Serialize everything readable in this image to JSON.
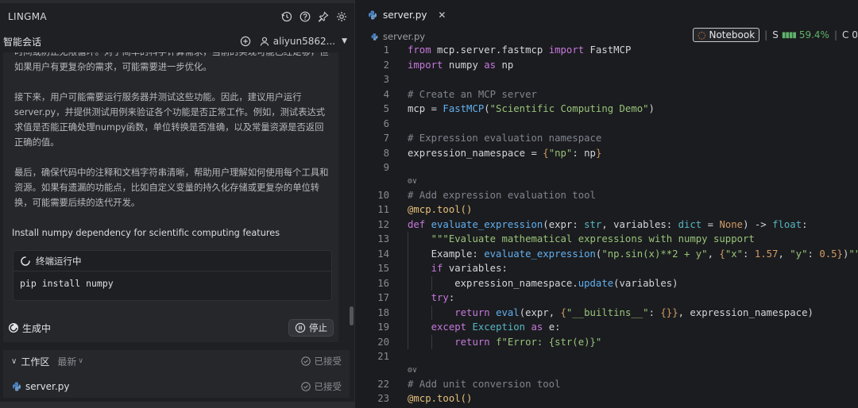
{
  "left_panel": {
    "app_title": "LINGMA",
    "header_icons": [
      "history-icon",
      "help-icon",
      "pin-icon",
      "settings-icon"
    ],
    "conversation": {
      "title": "智能会话",
      "user": "aliyun5862...",
      "paragraphs": [
        "时间或防止无限循环。对于简单的科学计算需求，当前的实现可能已经足够，但如果用户有更复杂的需求，可能需要进一步优化。",
        "接下来，用户可能需要运行服务器并测试这些功能。因此，建议用户运行server.py，并提供测试用例来验证各个功能是否正常工作。例如，测试表达式求值是否能正确处理numpy函数，单位转换是否准确，以及常量资源是否返回正确的值。",
        "最后，确保代码中的注释和文档字符串清晰，帮助用户理解如何使用每个工具和资源。如果有遗漏的功能点，比如自定义变量的持久化存储或更复杂的单位转换，可能需要后续的迭代开发。"
      ]
    },
    "task": {
      "title": "Install numpy dependency for scientific computing features",
      "terminal_status": "终端运行中",
      "command": "pip install numpy"
    },
    "generating": {
      "label": "生成中",
      "stop_label": "停止"
    },
    "workspace": {
      "title": "工作区",
      "sort": "最新",
      "status": "已接受",
      "file": "server.py",
      "file_status": "已接受"
    }
  },
  "editor": {
    "tab_label": "server.py",
    "breadcrumb": "server.py",
    "notebook_label": "Notebook",
    "perf_prefix": "S",
    "perf_value": "59.4%",
    "perf_suffix": "C 0",
    "lens_label": "⚙∨",
    "lines": [
      {
        "n": "1",
        "t": "from mcp.server.fastmcp import FastMCP"
      },
      {
        "n": "2",
        "t": "import numpy as np"
      },
      {
        "n": "3",
        "t": ""
      },
      {
        "n": "4",
        "t": "# Create an MCP server"
      },
      {
        "n": "5",
        "t": "mcp = FastMCP(\"Scientific Computing Demo\")"
      },
      {
        "n": "6",
        "t": ""
      },
      {
        "n": "7",
        "t": "# Expression evaluation namespace"
      },
      {
        "n": "8",
        "t": "expression_namespace = {\"np\": np}"
      },
      {
        "n": "9",
        "t": ""
      },
      {
        "n": "10",
        "t": "# Add expression evaluation tool"
      },
      {
        "n": "11",
        "t": "@mcp.tool()"
      },
      {
        "n": "12",
        "t": "def evaluate_expression(expr: str, variables: dict = None) -> float:"
      },
      {
        "n": "13",
        "t": "    \"\"\"Evaluate mathematical expressions with numpy support"
      },
      {
        "n": "14",
        "t": "    Example: evaluate_expression(\"np.sin(x)**2 + y\", {\"x\": 1.57, \"y\": 0.5})\"\"\""
      },
      {
        "n": "15",
        "t": "    if variables:"
      },
      {
        "n": "16",
        "t": "        expression_namespace.update(variables)"
      },
      {
        "n": "17",
        "t": "    try:"
      },
      {
        "n": "18",
        "t": "        return eval(expr, {\"__builtins__\": {}}, expression_namespace)"
      },
      {
        "n": "19",
        "t": "    except Exception as e:"
      },
      {
        "n": "20",
        "t": "        return f\"Error: {str(e)}\""
      },
      {
        "n": "21",
        "t": ""
      },
      {
        "n": "22",
        "t": "# Add unit conversion tool"
      },
      {
        "n": "23",
        "t": "@mcp.tool()"
      }
    ]
  }
}
